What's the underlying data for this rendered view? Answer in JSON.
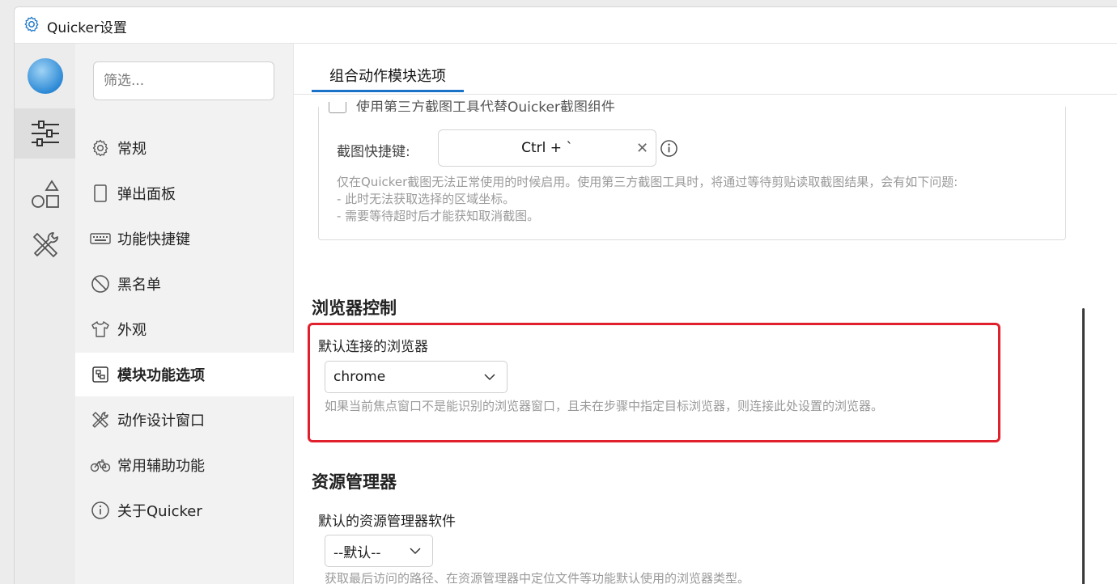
{
  "window": {
    "title": "Quicker设置"
  },
  "sidebar": {
    "filter_placeholder": "筛选...",
    "items": [
      {
        "label": "常规",
        "icon": "gear-icon"
      },
      {
        "label": "弹出面板",
        "icon": "panel-icon"
      },
      {
        "label": "功能快捷键",
        "icon": "keyboard-icon"
      },
      {
        "label": "黑名单",
        "icon": "ban-icon"
      },
      {
        "label": "外观",
        "icon": "tshirt-icon"
      },
      {
        "label": "模块功能选项",
        "icon": "module-icon",
        "active": true
      },
      {
        "label": "动作设计窗口",
        "icon": "design-tools-icon"
      },
      {
        "label": "常用辅助功能",
        "icon": "bicycle-icon"
      },
      {
        "label": "关于Quicker",
        "icon": "info-icon"
      }
    ]
  },
  "main": {
    "tab_label": "组合动作模块选项",
    "screenshot_panel": {
      "cut_text": "使用第三方截图工具代替Quicker截图组件",
      "hotkey_label": "截图快捷键:",
      "hotkey_value": "Ctrl + `",
      "clear_glyph": "✕",
      "desc_line1": "仅在Quicker截图无法正常使用的时候启用。使用第三方截图工具时，将通过等待剪贴读取截图结果，会有如下问题:",
      "desc_line2": "- 此时无法获取选择的区域坐标。",
      "desc_line3": "- 需要等待超时后才能获知取消截图。"
    },
    "browser_section": {
      "title": "浏览器控制",
      "field_label": "默认连接的浏览器",
      "selected": "chrome",
      "hint": "如果当前焦点窗口不是能识别的浏览器窗口，且未在步骤中指定目标浏览器，则连接此处设置的浏览器。"
    },
    "explorer_section": {
      "title": "资源管理器",
      "field_label": "默认的资源管理器软件",
      "selected": "--默认--",
      "hint": "获取最后访问的路径、在资源管理器中定位文件等功能默认使用的浏览器类型。"
    }
  },
  "colors": {
    "accent": "#1a73c9",
    "highlight_border": "#e0202c",
    "hint_text": "#9a9a9a"
  }
}
